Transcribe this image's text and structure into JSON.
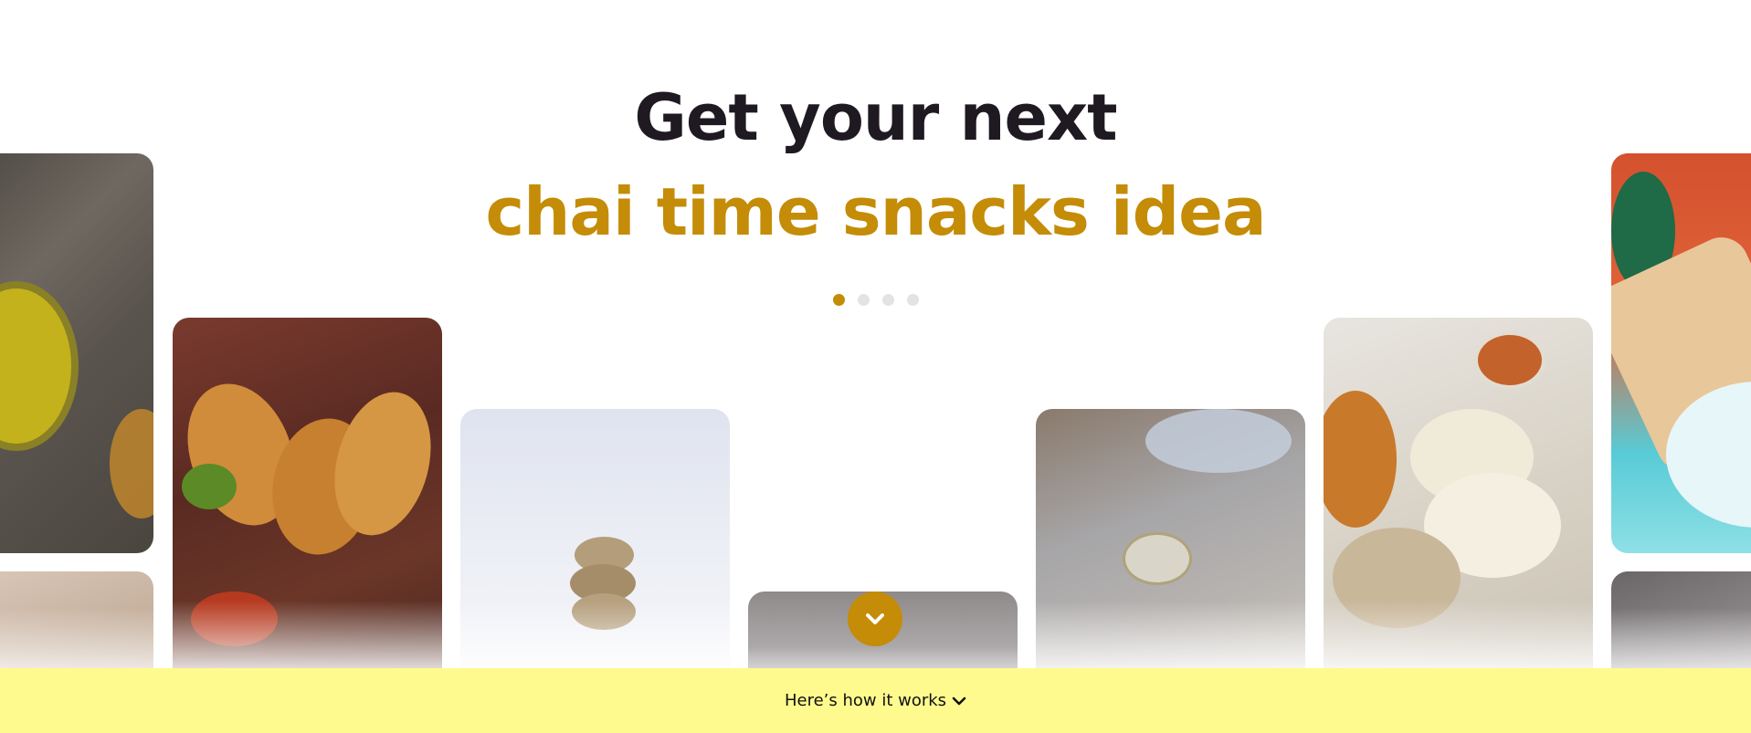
{
  "hero": {
    "title_line1": "Get your next",
    "title_line2": "chai time snacks idea",
    "carousel": {
      "slides": 4,
      "active": 1
    }
  },
  "footer_bar": {
    "label": "Here’s how it works"
  },
  "icons": {
    "scroll": "chevron-down-icon",
    "link": "chevron-down-icon"
  },
  "colors": {
    "accent": "#c48c07",
    "heading": "#1f1a22",
    "bar_background": "#fffa8e",
    "dot_inactive": "#e3e3e3"
  }
}
